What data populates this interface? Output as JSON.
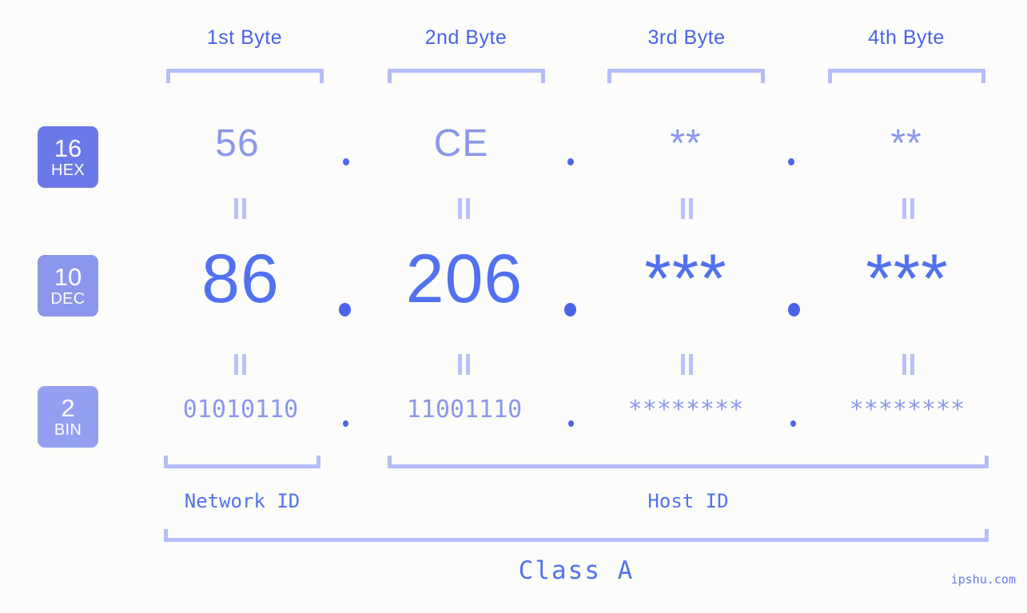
{
  "theme": {
    "background": "#fcfdfa",
    "accent_strong": "#4a63e7",
    "accent_mid": "#5271f0",
    "accent_light": "#8b97ec",
    "bracket": "#b4bdf7",
    "badge_hex_bg": "#6b79e8",
    "badge_dec_bg": "#8b97ec",
    "badge_bin_bg": "#93a0f2"
  },
  "byte_headers": [
    {
      "label": "1st Byte"
    },
    {
      "label": "2nd Byte"
    },
    {
      "label": "3rd Byte"
    },
    {
      "label": "4th Byte"
    }
  ],
  "bases": [
    {
      "num": "16",
      "abbr": "HEX"
    },
    {
      "num": "10",
      "abbr": "DEC"
    },
    {
      "num": "2",
      "abbr": "BIN"
    }
  ],
  "separator": ".",
  "rows": {
    "hex": {
      "values": [
        "56",
        "CE",
        "**",
        "**"
      ]
    },
    "dec": {
      "values": [
        "86",
        "206",
        "***",
        "***"
      ]
    },
    "bin": {
      "values": [
        "01010110",
        "11001110",
        "********",
        "********"
      ]
    }
  },
  "sections": {
    "network_id": "Network ID",
    "host_id": "Host ID",
    "class": "Class A"
  },
  "watermark": "ipshu.com"
}
